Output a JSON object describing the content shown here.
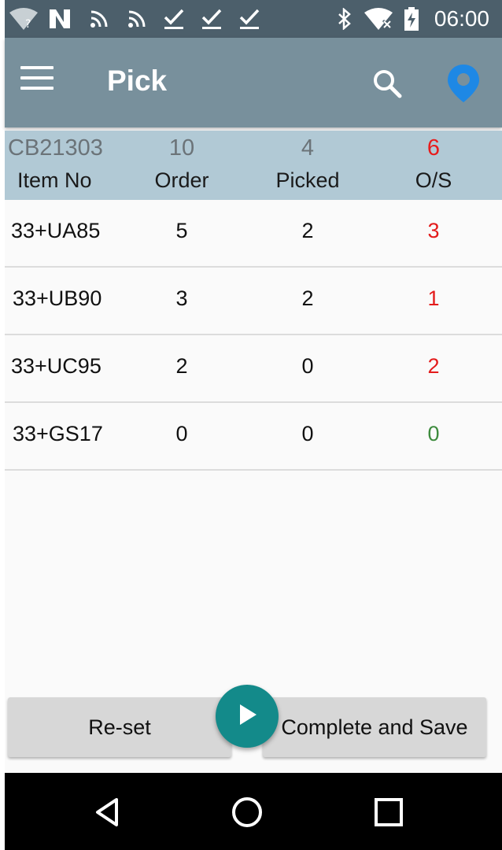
{
  "status_bar": {
    "time": "06:00",
    "icons": [
      "wifi-unknown-icon",
      "nfc-icon",
      "rss-icon",
      "rss-icon",
      "check-icon",
      "check-icon",
      "check-icon",
      "bluetooth-icon",
      "wifi-off-icon",
      "battery-charging-icon"
    ]
  },
  "toolbar": {
    "title": "Pick",
    "menu_icon": "hamburger-menu-icon",
    "search_icon": "search-icon",
    "location_icon": "location-pin-icon",
    "location_color": "#1e88e5"
  },
  "summary": {
    "doc_no": "CB21303",
    "order_total": "10",
    "picked_total": "4",
    "os_total": "6",
    "headers": {
      "item": "Item No",
      "order": "Order",
      "picked": "Picked",
      "os": "O/S"
    }
  },
  "items": [
    {
      "item_no": "33+UA85",
      "order": "5",
      "picked": "2",
      "os": "3"
    },
    {
      "item_no": "33+UB90",
      "order": "3",
      "picked": "2",
      "os": "1"
    },
    {
      "item_no": "33+UC95",
      "order": "2",
      "picked": "0",
      "os": "2"
    },
    {
      "item_no": "33+GS17",
      "order": "0",
      "picked": "0",
      "os": "0"
    }
  ],
  "buttons": {
    "reset": "Re-set",
    "complete": "Complete and Save",
    "fab_icon": "play-icon"
  },
  "nav": {
    "back": "back-icon",
    "home": "home-icon",
    "recents": "recents-icon"
  },
  "colors": {
    "toolbar": "#78909c",
    "summary": "#b1c9d5",
    "os_outstanding": "#e31b1b",
    "os_complete": "#3d8b3d",
    "fab": "#138a8a"
  }
}
